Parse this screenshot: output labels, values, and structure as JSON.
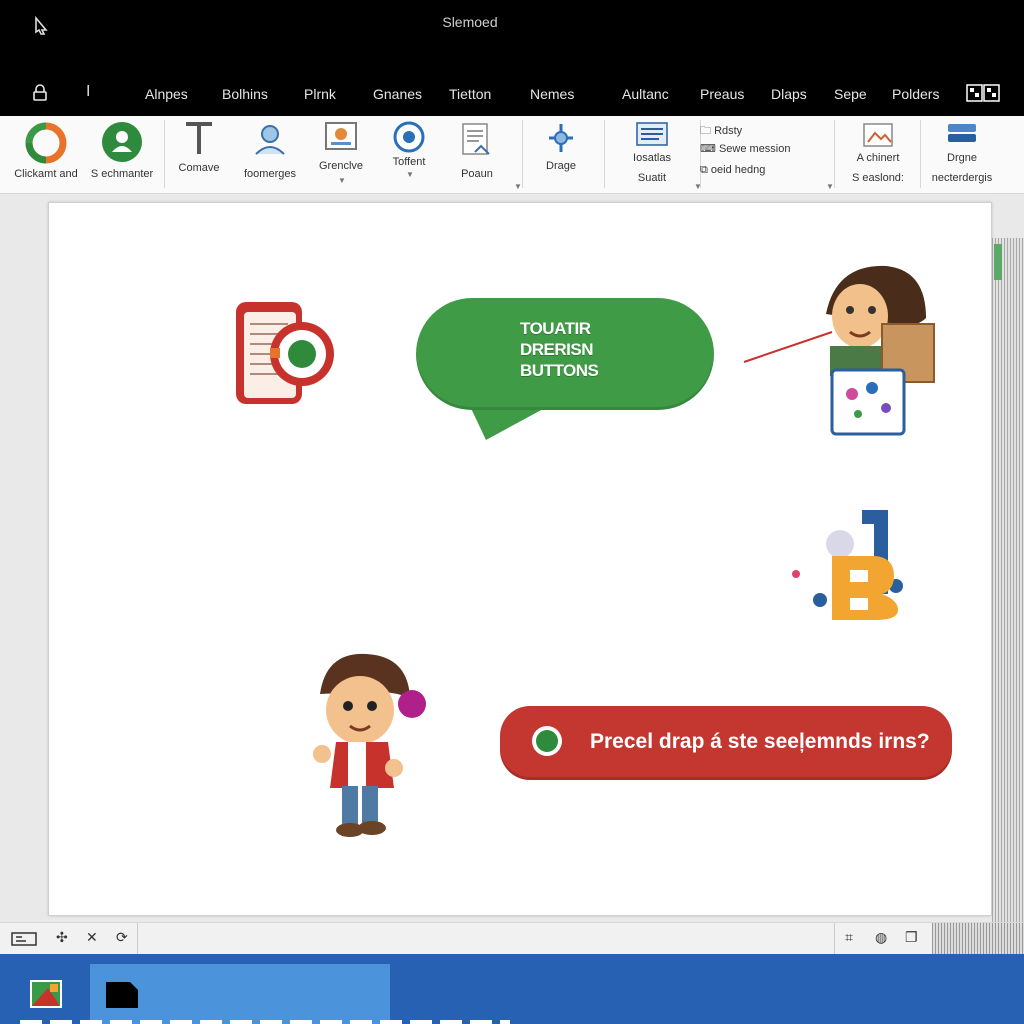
{
  "window": {
    "title": "Slemoed"
  },
  "menu": {
    "items": [
      "Alnpes",
      "Bolhins",
      "Plrnk",
      "Gnanes",
      "Tietton",
      "Nemes",
      "Aultanc",
      "Preaus",
      "Dlaps",
      "Sepe",
      "Polders"
    ]
  },
  "ribbon": {
    "clickamt": "Clickamt and",
    "sechmanter": "S echmanter",
    "connive": "Comave",
    "foomerges": "foomerges",
    "grenclve": "Grenclve",
    "toffent": "Toffent",
    "poaun": "Poaun",
    "drage": "Drage",
    "tosaths": "Iosatlas",
    "suatit": "Suatit",
    "rdsty": "Rdsty",
    "seewmenation": "Sewe mession",
    "oeuthedoing": "oeid hedng",
    "achinert": "A chinert",
    "seasiond": "S easlond:",
    "drgne": "Drgne",
    "netterdergis": "necterdergis"
  },
  "canvas": {
    "bubble_line1": "TOUATIR",
    "bubble_line2": "DRERISN",
    "bubble_line3": "BUTTONS",
    "pill_text": "Precel drap á ste seeļemnds irns?"
  },
  "colors": {
    "bubble": "#3f9b46",
    "pill": "#c43630",
    "taskbar": "#2761b4",
    "taskbar_active": "#4b94dc"
  },
  "icons": [
    "app-logo-icon",
    "lock-icon",
    "text-cursor-icon",
    "grid-view-icon",
    "ring-chart-icon",
    "green-person-icon",
    "text-tool-icon",
    "shapes-icon",
    "image-icon",
    "video-icon",
    "document-icon",
    "drag-icon",
    "list-icon",
    "folder-icon",
    "package-icon",
    "layers-icon",
    "fit-icon",
    "move-icon",
    "close-icon",
    "refresh-icon",
    "crop-icon",
    "globe-icon",
    "copy-icon",
    "windows-app-icon",
    "file-icon"
  ]
}
